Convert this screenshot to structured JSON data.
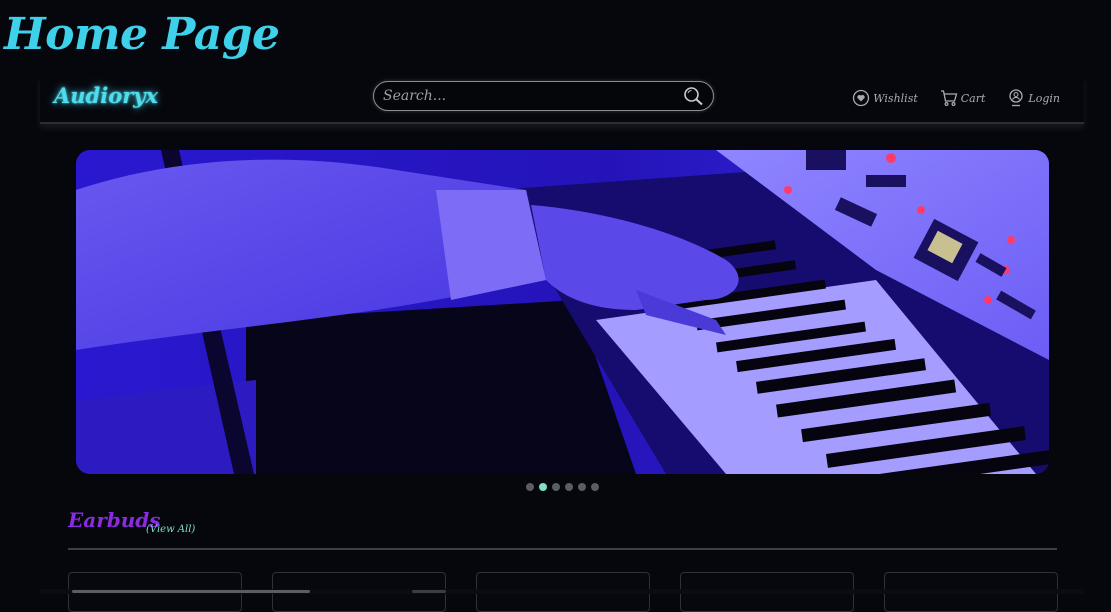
{
  "page": {
    "heading": "Home Page"
  },
  "navbar": {
    "brand": "Audioryx",
    "search": {
      "placeholder": "Search...",
      "value": ""
    },
    "links": [
      {
        "label": "Wishlist",
        "icon": "heart-icon"
      },
      {
        "label": "Cart",
        "icon": "cart-icon"
      },
      {
        "label": "Login",
        "icon": "user-icon"
      }
    ]
  },
  "carousel": {
    "image_alt": "Hands playing a keyboard synthesizer under blue light",
    "slide_count": 6,
    "active_slide": 2
  },
  "section": {
    "title": "Earbuds",
    "view_all": "(View All)"
  },
  "colors": {
    "background": "#06070d",
    "heading": "#3fd0ea",
    "brand": "#4fdcec",
    "section_title": "#8a2be2",
    "accent": "#7fe0c6"
  }
}
